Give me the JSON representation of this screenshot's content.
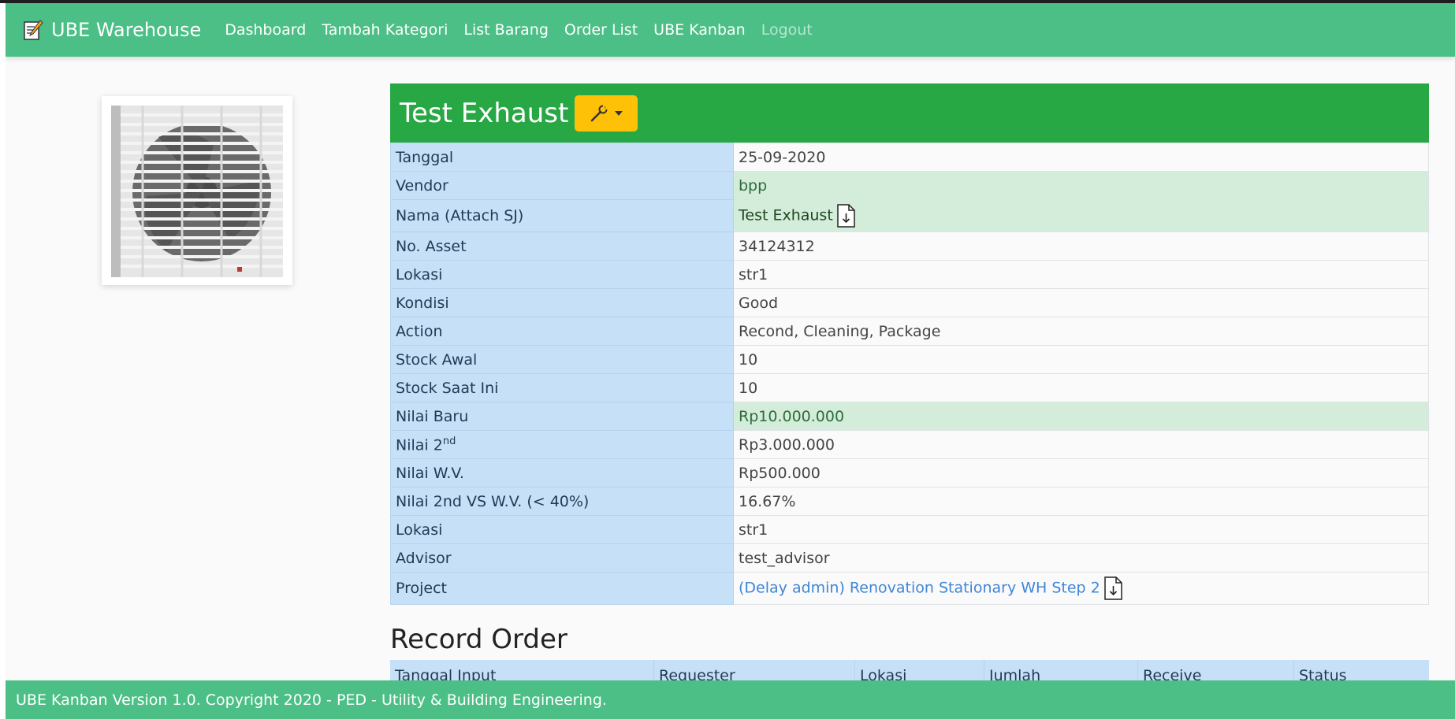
{
  "navbar": {
    "brand": "UBE Warehouse",
    "brand_icon": "memo-icon",
    "links": [
      "Dashboard",
      "Tambah Kategori",
      "List Barang",
      "Order List",
      "UBE Kanban"
    ],
    "logout": "Logout"
  },
  "item": {
    "title": "Test Exhaust",
    "image_icon": "exhaust-fan-photo",
    "tools_icon": "wrench-icon"
  },
  "details": {
    "rows": [
      {
        "label": "Tanggal",
        "value": "25-09-2020"
      },
      {
        "label": "Vendor",
        "value": "bpp"
      },
      {
        "label": "Nama (Attach SJ)",
        "value": "Test Exhaust"
      },
      {
        "label": "No. Asset",
        "value": "34124312"
      },
      {
        "label": "Lokasi",
        "value": "str1"
      },
      {
        "label": "Kondisi",
        "value": "Good"
      },
      {
        "label": "Action",
        "value": "Recond, Cleaning, Package"
      },
      {
        "label": "Stock Awal",
        "value": "10"
      },
      {
        "label": "Stock Saat Ini",
        "value": "10"
      },
      {
        "label": "Nilai Baru",
        "value": "Rp10.000.000"
      },
      {
        "label": "Nilai 2",
        "label_sup": "nd",
        "value": "Rp3.000.000"
      },
      {
        "label": "Nilai W.V.",
        "value": "Rp500.000"
      },
      {
        "label": "Nilai 2nd VS W.V. (< 40%)",
        "value": "16.67%"
      },
      {
        "label": "Lokasi",
        "value": "str1"
      },
      {
        "label": "Advisor",
        "value": "test_advisor"
      },
      {
        "label": "Project",
        "value": "(Delay admin) Renovation Stationary WH Step 2"
      }
    ]
  },
  "record_order": {
    "title": "Record Order",
    "columns": [
      "Tanggal Input",
      "Requester",
      "Lokasi",
      "Jumlah",
      "Receive",
      "Status"
    ]
  },
  "footer": {
    "text": "UBE Kanban Version 1.0. Copyright 2020 - PED - Utility & Building Engineering."
  },
  "colors": {
    "navbar": "#4bbf86",
    "card_header": "#28a745",
    "label_cell": "#c6e0f7",
    "highlight_row": "#d4edda",
    "tool_button": "#ffc107",
    "link": "#3f86d8"
  }
}
